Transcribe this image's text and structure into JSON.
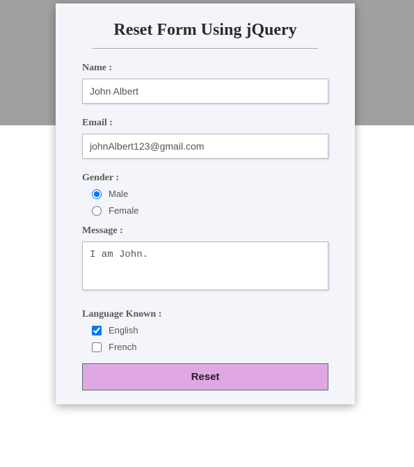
{
  "title": "Reset Form Using jQuery",
  "fields": {
    "name": {
      "label": "Name :",
      "value": "John Albert"
    },
    "email": {
      "label": "Email :",
      "value": "johnAlbert123@gmail.com"
    },
    "gender": {
      "label": "Gender :",
      "options": [
        {
          "label": "Male",
          "checked": true
        },
        {
          "label": "Female",
          "checked": false
        }
      ]
    },
    "message": {
      "label": "Message :",
      "value": "I am John."
    },
    "language": {
      "label": "Language Known :",
      "options": [
        {
          "label": "English",
          "checked": true
        },
        {
          "label": "French",
          "checked": false
        }
      ]
    }
  },
  "button": {
    "reset_label": "Reset"
  }
}
